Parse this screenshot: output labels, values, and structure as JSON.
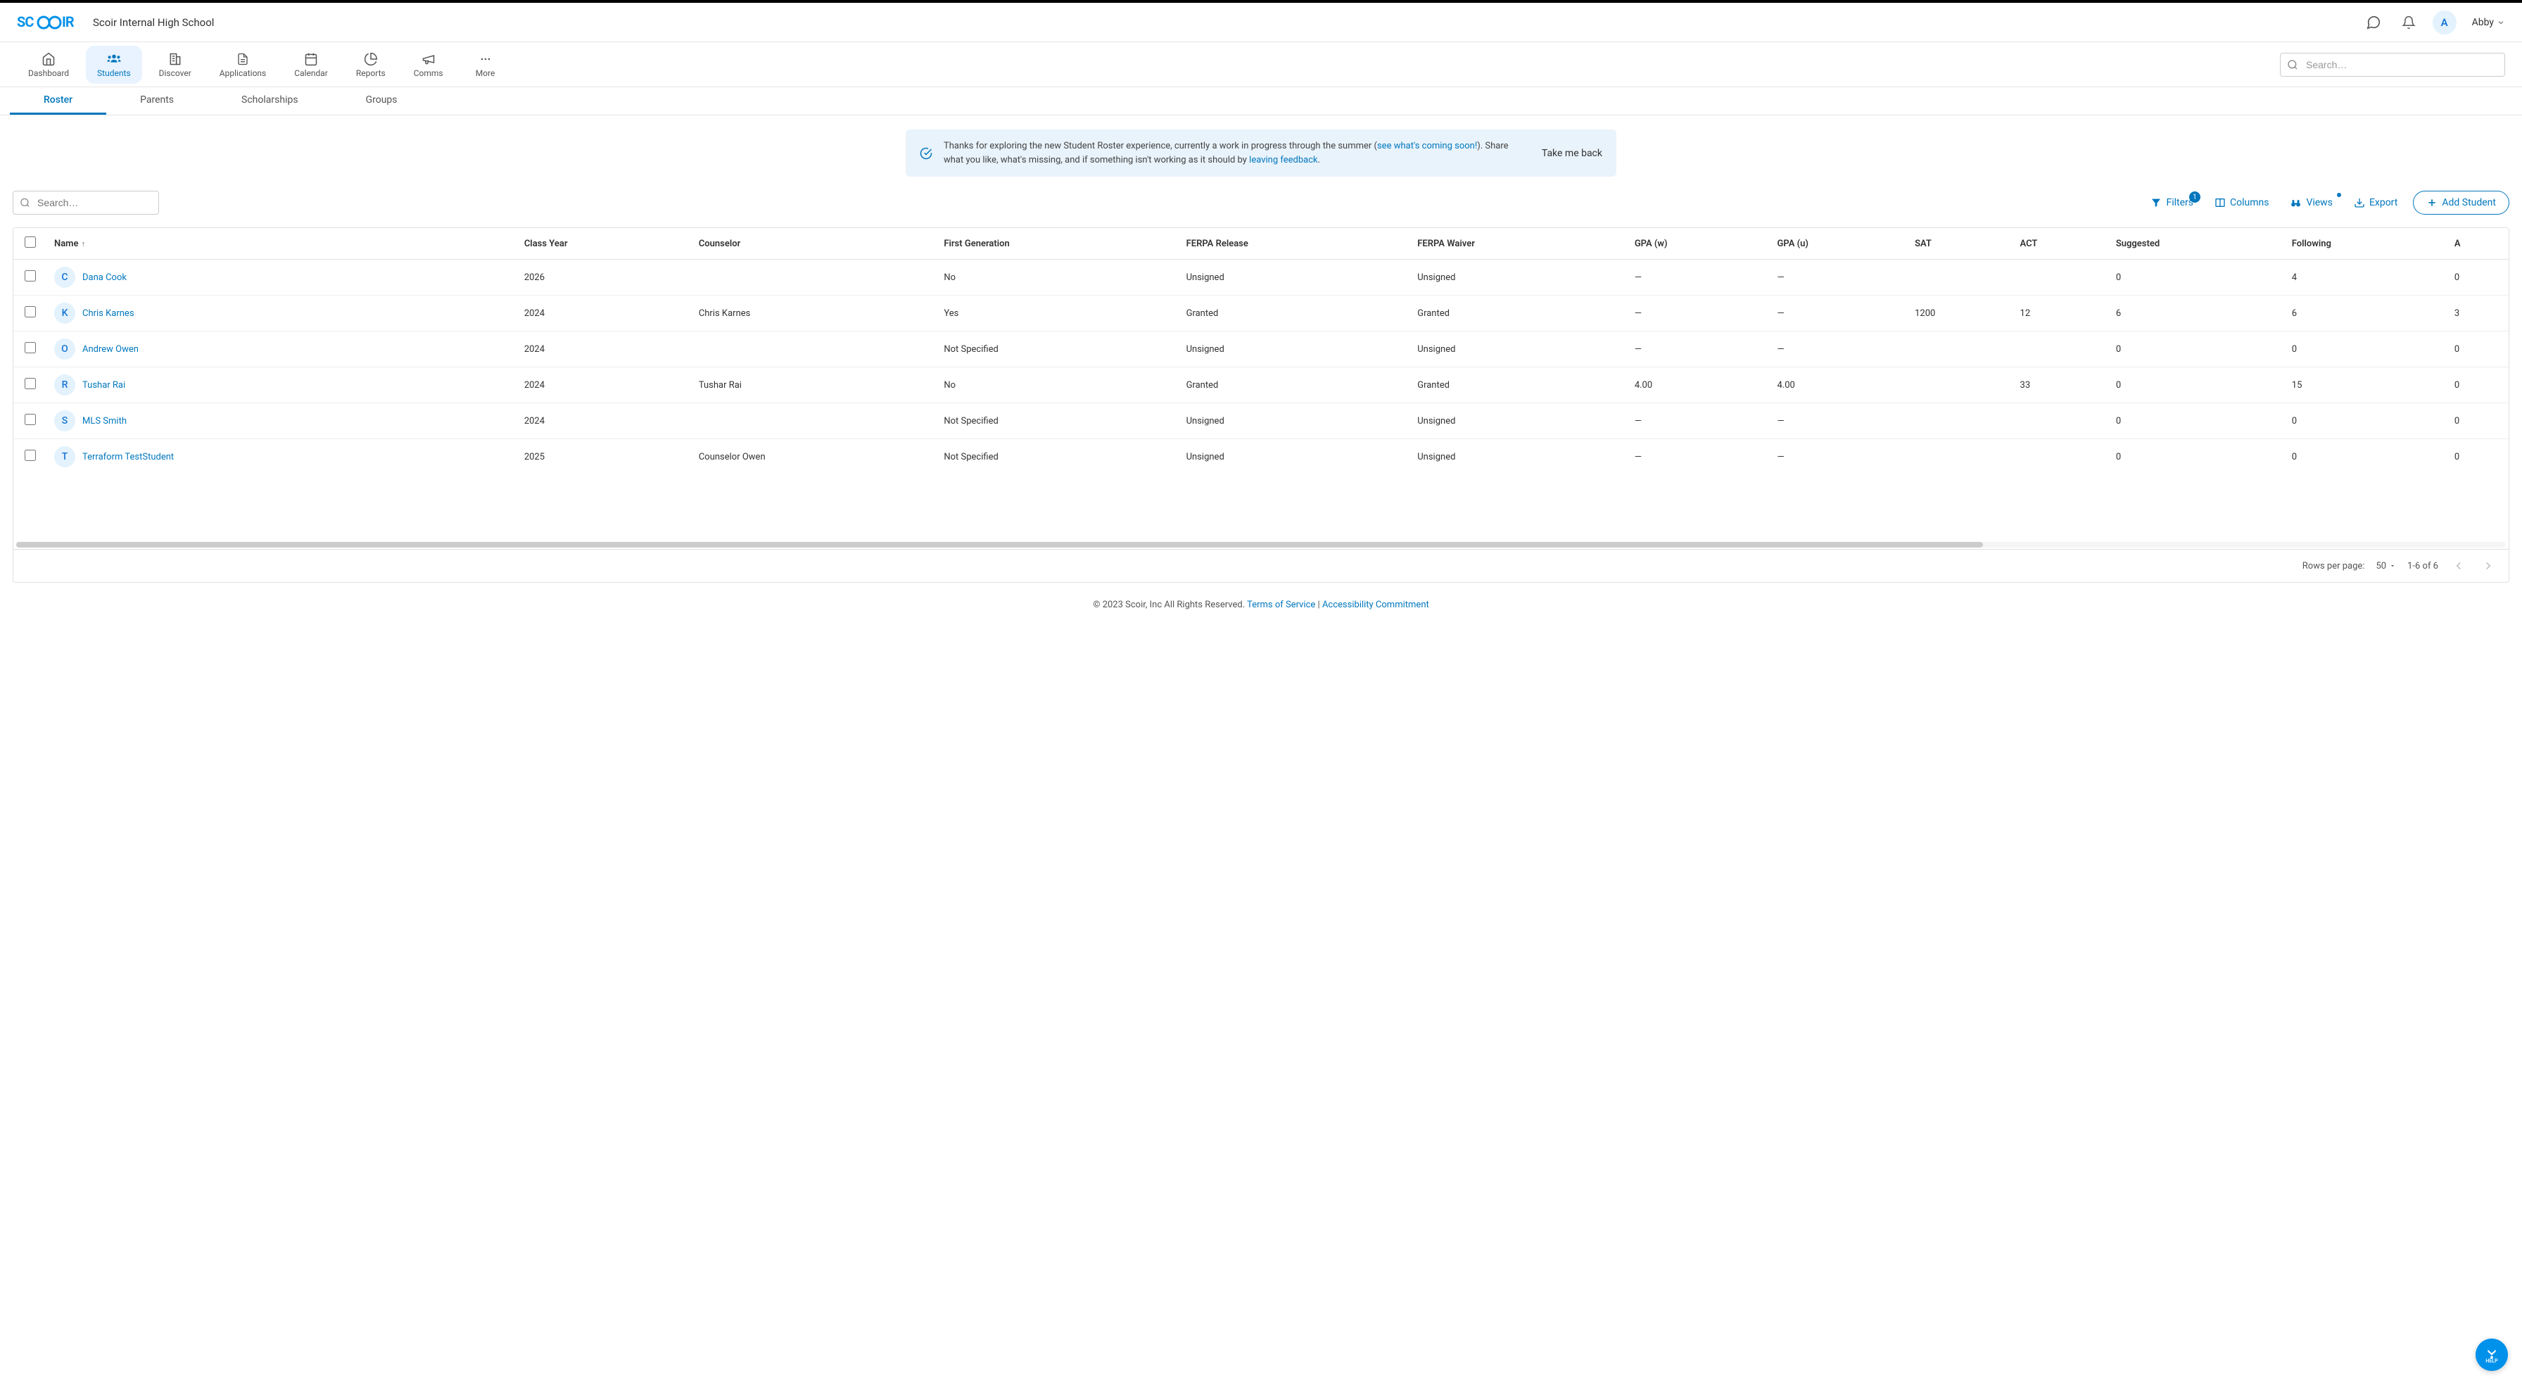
{
  "header": {
    "logo_text": "SCOIR",
    "school": "Scoir Internal High School",
    "user_initial": "A",
    "user_name": "Abby"
  },
  "nav": {
    "items": [
      {
        "label": "Dashboard",
        "icon": "home"
      },
      {
        "label": "Students",
        "icon": "people",
        "active": true
      },
      {
        "label": "Discover",
        "icon": "building"
      },
      {
        "label": "Applications",
        "icon": "doc"
      },
      {
        "label": "Calendar",
        "icon": "calendar"
      },
      {
        "label": "Reports",
        "icon": "pie"
      },
      {
        "label": "Comms",
        "icon": "megaphone"
      },
      {
        "label": "More",
        "icon": "dots"
      }
    ],
    "search_placeholder": "Search…"
  },
  "subtabs": [
    {
      "label": "Roster",
      "active": true
    },
    {
      "label": "Parents"
    },
    {
      "label": "Scholarships"
    },
    {
      "label": "Groups"
    }
  ],
  "banner": {
    "text_before": "Thanks for exploring the new Student Roster experience, currently a work in progress through the summer (",
    "link1": "see what's coming soon!",
    "text_mid": "). Share what you like, what's missing, and if something isn't working as it should by ",
    "link2": "leaving feedback",
    "text_after": ".",
    "action": "Take me back"
  },
  "toolbar": {
    "search_placeholder": "Search…",
    "filters_label": "Filters",
    "filters_count": "1",
    "columns_label": "Columns",
    "views_label": "Views",
    "export_label": "Export",
    "add_label": "Add Student"
  },
  "table": {
    "columns": [
      "Name",
      "Class Year",
      "Counselor",
      "First Generation",
      "FERPA Release",
      "FERPA Waiver",
      "GPA (w)",
      "GPA (u)",
      "SAT",
      "ACT",
      "Suggested",
      "Following",
      "A"
    ],
    "rows": [
      {
        "initial": "C",
        "name": "Dana Cook",
        "avatar_bg": "#e3f2fd",
        "avatar_color": "#1976d2",
        "class_year": "2026",
        "counselor": "",
        "first_gen": "No",
        "ferpa_release": "Unsigned",
        "ferpa_waiver": "Unsigned",
        "gpa_w": "—",
        "gpa_u": "—",
        "sat": "",
        "act": "",
        "suggested": "0",
        "following": "4",
        "a": "0"
      },
      {
        "initial": "K",
        "name": "Chris Karnes",
        "avatar_bg": "#e3f2fd",
        "avatar_color": "#1976d2",
        "class_year": "2024",
        "counselor": "Chris Karnes",
        "first_gen": "Yes",
        "ferpa_release": "Granted",
        "ferpa_waiver": "Granted",
        "gpa_w": "—",
        "gpa_u": "—",
        "sat": "1200",
        "act": "12",
        "suggested": "6",
        "following": "6",
        "a": "3"
      },
      {
        "initial": "O",
        "name": "Andrew Owen",
        "avatar_bg": "#e3f2fd",
        "avatar_color": "#1976d2",
        "class_year": "2024",
        "counselor": "",
        "first_gen": "Not Specified",
        "ferpa_release": "Unsigned",
        "ferpa_waiver": "Unsigned",
        "gpa_w": "—",
        "gpa_u": "—",
        "sat": "",
        "act": "",
        "suggested": "0",
        "following": "0",
        "a": "0"
      },
      {
        "initial": "R",
        "name": "Tushar Rai",
        "avatar_bg": "#e3f2fd",
        "avatar_color": "#1976d2",
        "class_year": "2024",
        "counselor": "Tushar Rai",
        "first_gen": "No",
        "ferpa_release": "Granted",
        "ferpa_waiver": "Granted",
        "gpa_w": "4.00",
        "gpa_u": "4.00",
        "sat": "",
        "act": "33",
        "suggested": "0",
        "following": "15",
        "a": "0"
      },
      {
        "initial": "S",
        "name": "MLS Smith",
        "avatar_bg": "#e3f2fd",
        "avatar_color": "#1976d2",
        "class_year": "2024",
        "counselor": "",
        "first_gen": "Not Specified",
        "ferpa_release": "Unsigned",
        "ferpa_waiver": "Unsigned",
        "gpa_w": "—",
        "gpa_u": "—",
        "sat": "",
        "act": "",
        "suggested": "0",
        "following": "0",
        "a": "0"
      },
      {
        "initial": "T",
        "name": "Terraform TestStudent",
        "avatar_bg": "#e3f2fd",
        "avatar_color": "#1976d2",
        "class_year": "2025",
        "counselor": "Counselor Owen",
        "first_gen": "Not Specified",
        "ferpa_release": "Unsigned",
        "ferpa_waiver": "Unsigned",
        "gpa_w": "—",
        "gpa_u": "—",
        "sat": "",
        "act": "",
        "suggested": "0",
        "following": "0",
        "a": "0"
      }
    ]
  },
  "pagination": {
    "rows_label": "Rows per page:",
    "page_size": "50",
    "range": "1-6 of 6"
  },
  "footer": {
    "copyright": "© 2023 Scoir, Inc All Rights Reserved. ",
    "terms": "Terms of Service",
    "sep": " | ",
    "accessibility": "Accessibility Commitment"
  },
  "help_label": "HELP"
}
